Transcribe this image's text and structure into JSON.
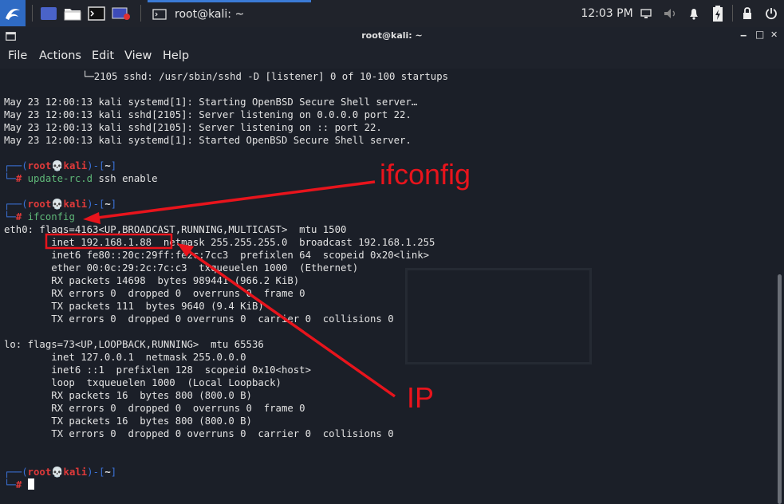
{
  "taskbar": {
    "window_title": "root@kali: ~",
    "clock": "12:03 PM"
  },
  "titlebar": {
    "title": "root@kali: ~",
    "min": "‒",
    "max": "□",
    "close": "✕"
  },
  "menu": {
    "file": "File",
    "actions": "Actions",
    "edit": "Edit",
    "view": "View",
    "help": "Help"
  },
  "terminal": {
    "tree_line": "└─2105 sshd: /usr/sbin/sshd -D [listener] 0 of 10-100 startups",
    "log1": "May 23 12:00:13 kali systemd[1]: Starting OpenBSD Secure Shell server…",
    "log2": "May 23 12:00:13 kali sshd[2105]: Server listening on 0.0.0.0 port 22.",
    "log3": "May 23 12:00:13 kali sshd[2105]: Server listening on :: port 22.",
    "log4": "May 23 12:00:13 kali systemd[1]: Started OpenBSD Secure Shell server.",
    "prompt_open": "┌──(",
    "prompt_user": "root💀kali",
    "prompt_mid": ")-[",
    "prompt_dir": "~",
    "prompt_close": "]",
    "prompt_hash_pre": "└─",
    "prompt_hash": "#",
    "cmd1": "update-rc.d",
    "cmd1_args": "ssh enable",
    "cmd2": "ifconfig",
    "eth0_flags": "eth0: flags=4163<UP,BROADCAST,RUNNING,MULTICAST>  mtu 1500",
    "eth0_inet": "        inet 192.168.1.88  netmask 255.255.255.0  broadcast 192.168.1.255",
    "eth0_inet6": "        inet6 fe80::20c:29ff:fe2c:7cc3  prefixlen 64  scopeid 0x20<link>",
    "eth0_ether": "        ether 00:0c:29:2c:7c:c3  txqueuelen 1000  (Ethernet)",
    "eth0_rxp": "        RX packets 14698  bytes 989441 (966.2 KiB)",
    "eth0_rxe": "        RX errors 0  dropped 0  overruns 0  frame 0",
    "eth0_txp": "        TX packets 111  bytes 9640 (9.4 KiB)",
    "eth0_txe": "        TX errors 0  dropped 0 overruns 0  carrier 0  collisions 0",
    "lo_flags": "lo: flags=73<UP,LOOPBACK,RUNNING>  mtu 65536",
    "lo_inet": "        inet 127.0.0.1  netmask 255.0.0.0",
    "lo_inet6": "        inet6 ::1  prefixlen 128  scopeid 0x10<host>",
    "lo_loop": "        loop  txqueuelen 1000  (Local Loopback)",
    "lo_rxp": "        RX packets 16  bytes 800 (800.0 B)",
    "lo_rxe": "        RX errors 0  dropped 0  overruns 0  frame 0",
    "lo_txp": "        TX packets 16  bytes 800 (800.0 B)",
    "lo_txe": "        TX errors 0  dropped 0 overruns 0  carrier 0  collisions 0"
  },
  "annotations": {
    "ifconfig_label": "ifconfig",
    "ip_label": "IP"
  },
  "colors": {
    "prompt_blue": "#3b73d9",
    "prompt_red": "#e03a3a",
    "annotation_red": "#e8141c",
    "command_green": "#5fb878"
  }
}
